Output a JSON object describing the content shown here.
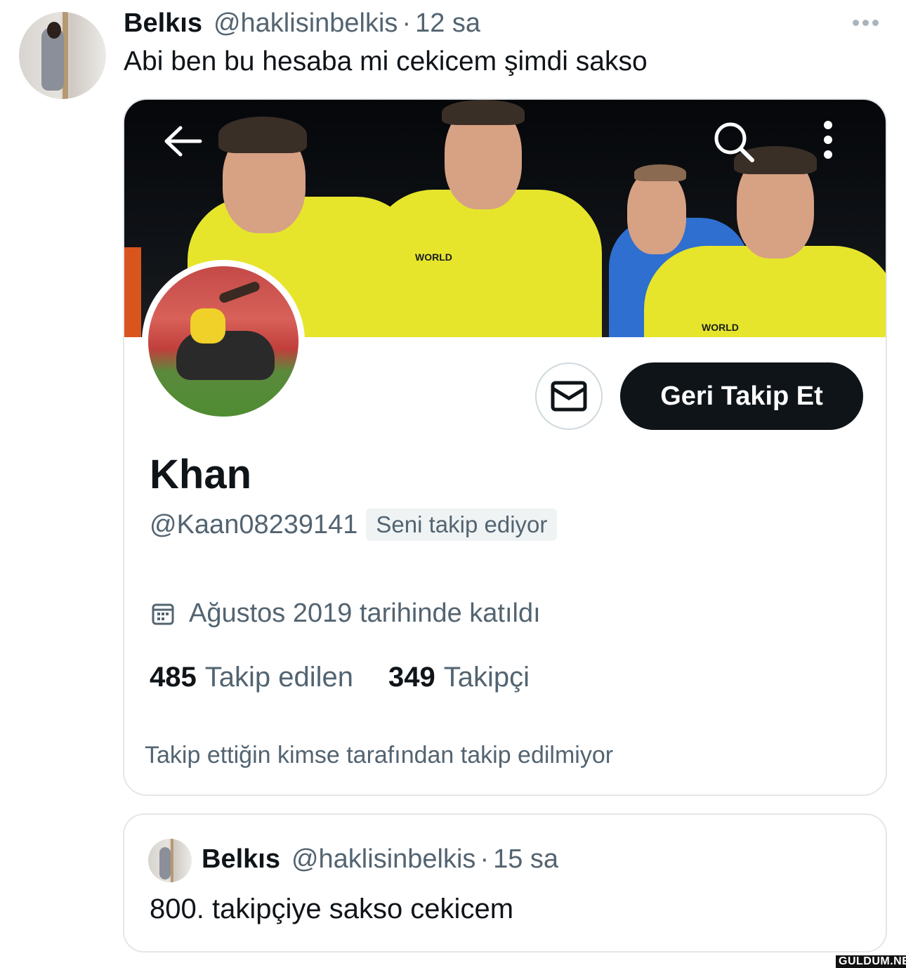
{
  "tweet": {
    "author_name": "Belkıs",
    "author_handle": "@haklisinbelkis",
    "separator": "·",
    "time": "12 sa",
    "text": "Abi ben bu hesaba mi cekicem şimdi sakso",
    "more_icon": "more-horizontal-icon"
  },
  "profile_card": {
    "icons": {
      "back": "arrow-left-icon",
      "search": "search-icon",
      "more": "more-vertical-icon",
      "message": "envelope-icon",
      "calendar": "calendar-icon"
    },
    "banner_words": [
      "WORLD",
      "WORLD"
    ],
    "follow_button": "Geri Takip Et",
    "display_name": "Khan",
    "handle": "@Kaan08239141",
    "follows_you": "Seni takip ediyor",
    "joined": "Ağustos 2019 tarihinde katıldı",
    "following_count": "485",
    "following_label": "Takip edilen",
    "followers_count": "349",
    "followers_label": "Takipçi",
    "mutuals_note": "Takip ettiğin kimse tarafından takip edilmiyor"
  },
  "quoted_tweet": {
    "author_name": "Belkıs",
    "author_handle": "@haklisinbelkis",
    "separator": "·",
    "time": "15 sa",
    "text": "800. takipçiye sakso cekicem"
  },
  "watermark": "GULDUM.NET",
  "colors": {
    "text": "#0f1419",
    "secondary": "#536471",
    "border": "#e3e7ea",
    "button_bg": "#0f1419",
    "jersey": "#e6e52c"
  }
}
